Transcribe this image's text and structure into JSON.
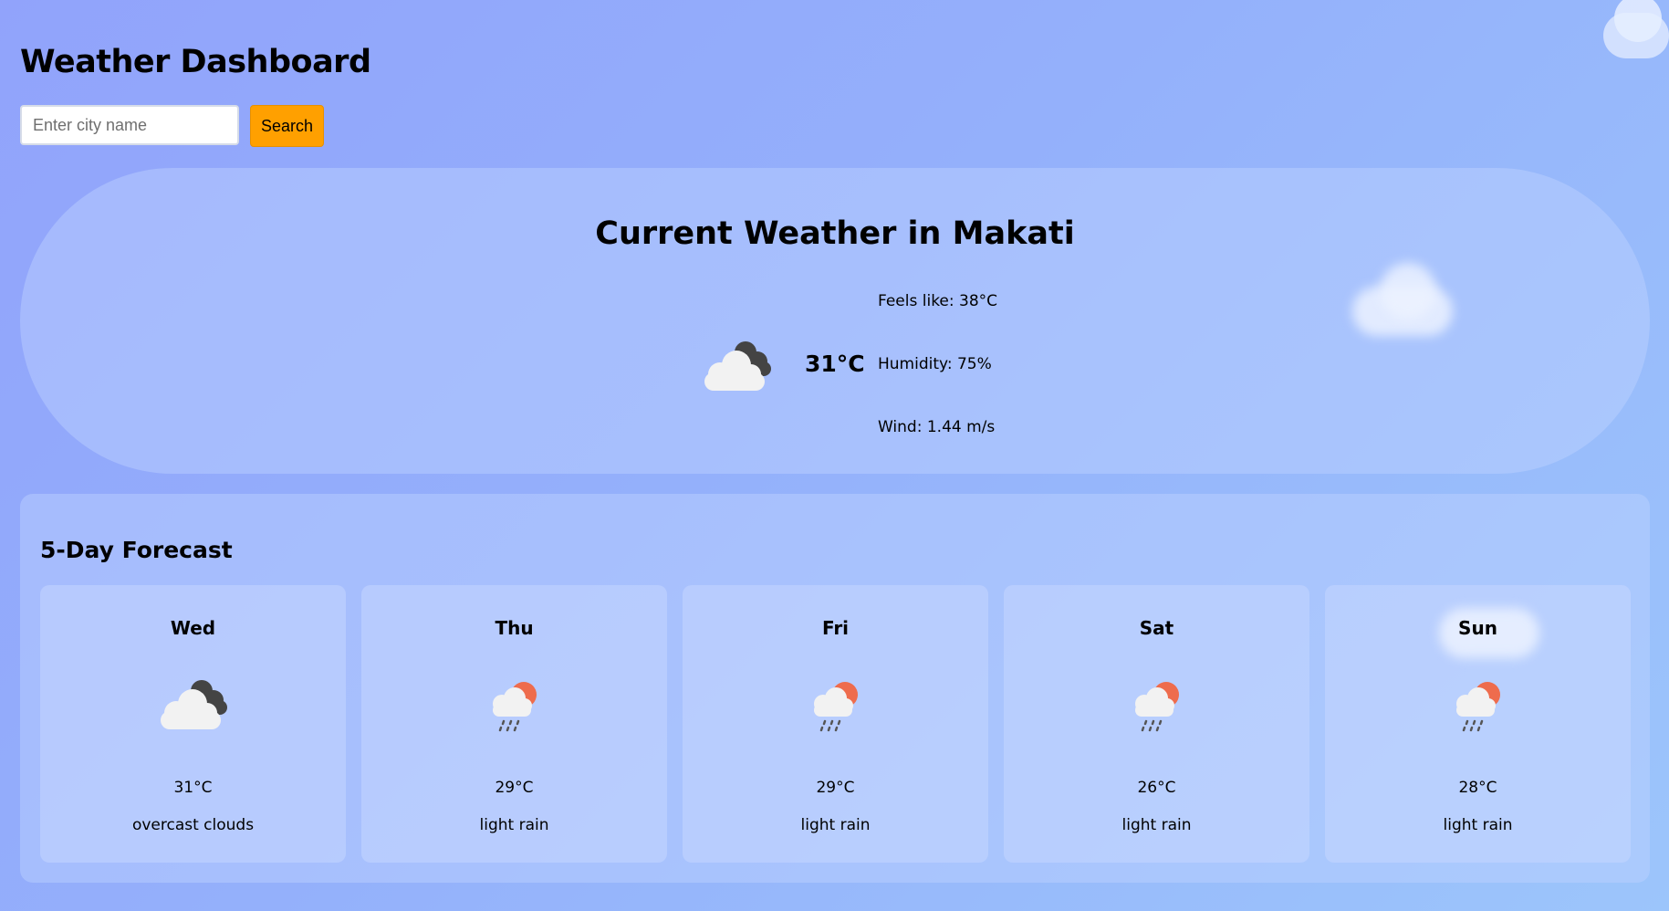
{
  "app": {
    "title": "Weather Dashboard"
  },
  "search": {
    "placeholder": "Enter city name",
    "value": "",
    "button_label": "Search"
  },
  "current": {
    "title": "Current Weather in Makati",
    "icon": "overcast-clouds-icon",
    "temperature": "31°C",
    "feels_like": "Feels like: 38°C",
    "humidity": "Humidity: 75%",
    "wind": "Wind: 1.44 m/s"
  },
  "forecast": {
    "title": "5-Day Forecast",
    "days": [
      {
        "day": "Wed",
        "icon": "overcast-clouds-icon",
        "temp": "31°C",
        "desc": "overcast clouds"
      },
      {
        "day": "Thu",
        "icon": "light-rain-icon",
        "temp": "29°C",
        "desc": "light rain"
      },
      {
        "day": "Fri",
        "icon": "light-rain-icon",
        "temp": "29°C",
        "desc": "light rain"
      },
      {
        "day": "Sat",
        "icon": "light-rain-icon",
        "temp": "26°C",
        "desc": "light rain"
      },
      {
        "day": "Sun",
        "icon": "light-rain-icon",
        "temp": "28°C",
        "desc": "light rain"
      }
    ]
  },
  "colors": {
    "accent": "#ffa000",
    "background_start": "#91a3fb",
    "background_end": "#9cc5fb",
    "sun": "#ee6c4d",
    "dark_cloud": "#444444"
  }
}
